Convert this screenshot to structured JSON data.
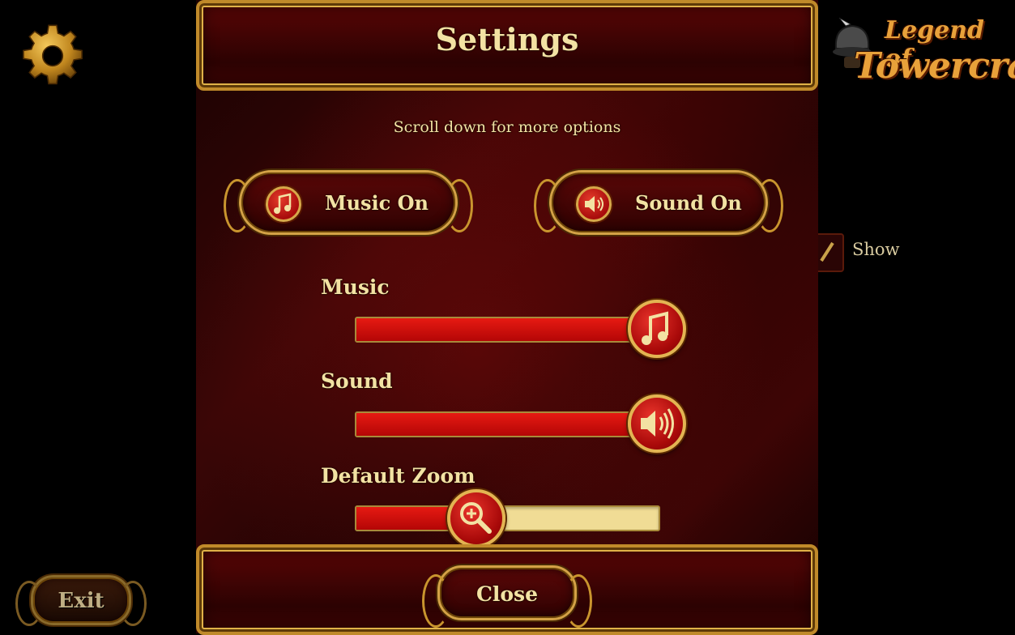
{
  "title": "Settings",
  "hint": "Scroll down for more options",
  "toggles": {
    "music_label": "Music On",
    "sound_label": "Sound On",
    "music_icon": "music-note-icon",
    "sound_icon": "speaker-icon"
  },
  "sliders": [
    {
      "label": "Music",
      "value_fraction": 1.0,
      "knob_icon": "music-note-icon"
    },
    {
      "label": "Sound",
      "value_fraction": 1.0,
      "knob_icon": "speaker-icon"
    },
    {
      "label": "Default Zoom",
      "value_fraction": 0.4,
      "knob_icon": "zoom-in-icon"
    }
  ],
  "close_label": "Close",
  "exit_label": "Exit",
  "background": {
    "show_label": "Show"
  },
  "logo": {
    "line1": "Legend of",
    "line2": "Towercraft"
  },
  "colors": {
    "accent_red": "#c40a0a",
    "gold": "#d6a84a",
    "track": "#f0dc95",
    "text": "#f3e2a3"
  }
}
